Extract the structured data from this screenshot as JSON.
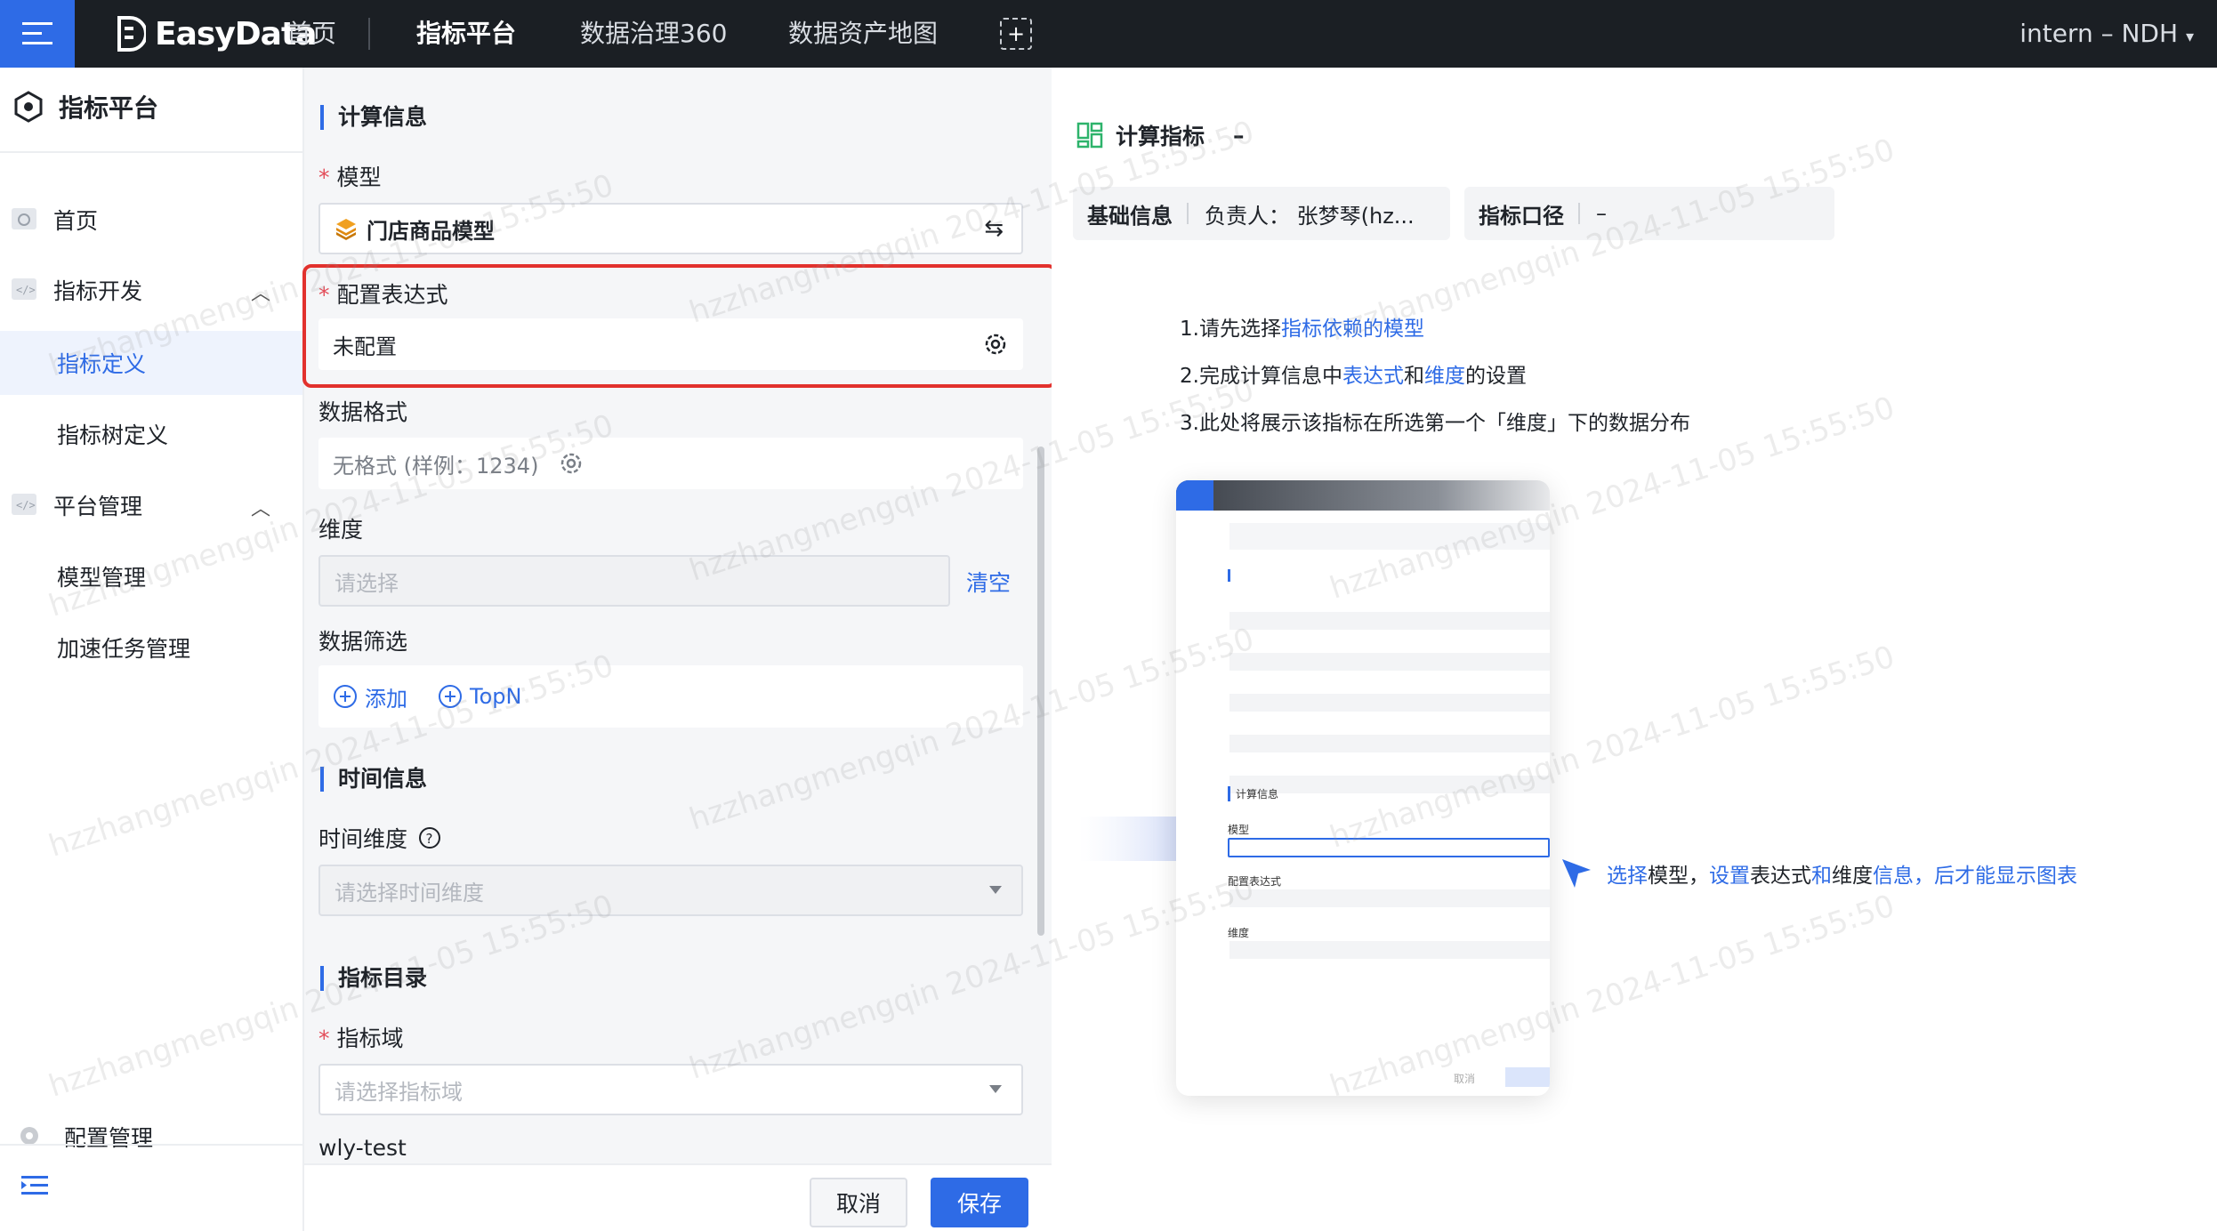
{
  "topbar": {
    "logo_text": "EasyData",
    "nav": [
      "首页",
      "指标平台",
      "数据治理360",
      "数据资产地图"
    ],
    "user": "intern – NDH"
  },
  "sidebar": {
    "title": "指标平台",
    "items": {
      "home": "首页",
      "metric_dev": "指标开发",
      "metric_def": "指标定义",
      "metric_tree": "指标树定义",
      "platform_mgmt": "平台管理",
      "model_mgmt": "模型管理",
      "accel_task": "加速任务管理"
    },
    "config_mgmt": "配置管理"
  },
  "form": {
    "section_calc": "计算信息",
    "model_label": "模型",
    "model_value": "门店商品模型",
    "expr_label": "配置表达式",
    "expr_value": "未配置",
    "format_label": "数据格式",
    "format_value": "无格式 (样例：1234)",
    "dim_label": "维度",
    "dim_placeholder": "请选择",
    "dim_clear": "清空",
    "filter_label": "数据筛选",
    "filter_add": "添加",
    "filter_topn": "TopN",
    "section_time": "时间信息",
    "time_dim_label": "时间维度",
    "time_dim_placeholder": "请选择时间维度",
    "section_catalog": "指标目录",
    "domain_label": "指标域",
    "domain_placeholder": "请选择指标域",
    "domain_value": "wly-test"
  },
  "footer": {
    "cancel": "取消",
    "save": "保存"
  },
  "preview": {
    "title": "计算指标",
    "title_suffix": "–",
    "basic_label": "基础信息",
    "owner": "负责人：  张梦琴(hz...",
    "caliber_label": "指标口径",
    "caliber_value": "–",
    "step1_prefix": "1.请先选择",
    "step1_link": "指标依赖的模型",
    "step2_prefix": "2.完成计算信息中",
    "step2_link1": "表达式",
    "step2_mid": "和",
    "step2_link2": "维度",
    "step2_suffix": "的设置",
    "step3": "3.此处将展示该指标在所选第一个「维度」下的数据分布",
    "hint_1": "选择",
    "hint_2": "模型，",
    "hint_3": "设置",
    "hint_4": "表达式",
    "hint_5": "和",
    "hint_6": "维度",
    "hint_7": "信息，后才能显示图表",
    "ill_section": "计算信息",
    "ill_model": "模型",
    "ill_expr": "配置表达式",
    "ill_dim": "维度",
    "ill_cancel": "取消"
  },
  "watermark": "hzzhangmengqin 2024-11-05 15:55:50",
  "colors": {
    "accent": "#2e6be6",
    "topbar": "#1b1f24",
    "highlight": "#e2312d",
    "required": "#e34d59"
  }
}
